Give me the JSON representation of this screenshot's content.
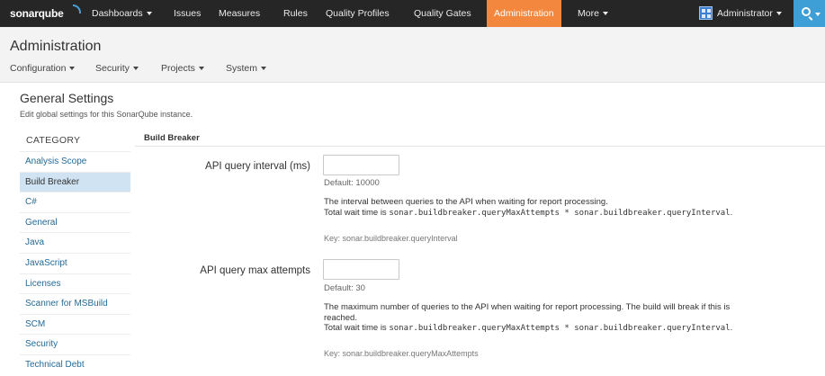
{
  "topnav": {
    "logo": "sonarqube",
    "items": [
      {
        "label": "Dashboards",
        "caret": true
      },
      {
        "label": "Issues"
      },
      {
        "label": "Measures"
      },
      {
        "label": "Rules"
      },
      {
        "label": "Quality Profiles"
      },
      {
        "label": "Quality Gates"
      },
      {
        "label": "Administration",
        "active": true
      },
      {
        "label": "More",
        "caret": true
      }
    ],
    "user": "Administrator",
    "search_icon": "search-icon",
    "colors": {
      "bar": "#262626",
      "active": "#f4873e",
      "search": "#3d9fd6"
    }
  },
  "header": {
    "title": "Administration",
    "menus": [
      "Configuration",
      "Security",
      "Projects",
      "System"
    ]
  },
  "general": {
    "title": "General Settings",
    "description": "Edit global settings for this SonarQube instance."
  },
  "sidebar": {
    "heading": "CATEGORY",
    "items": [
      "Analysis Scope",
      "Build Breaker",
      "C#",
      "General",
      "Java",
      "JavaScript",
      "Licenses",
      "Scanner for MSBuild",
      "SCM",
      "Security",
      "Technical Debt"
    ],
    "active": "Build Breaker"
  },
  "main": {
    "section_title": "Build Breaker",
    "settings": [
      {
        "label": "API query interval (ms)",
        "value": "",
        "default": "Default: 10000",
        "desc_lines": [
          "The interval between queries to the API when waiting for report processing."
        ],
        "total_prefix": "Total wait time is ",
        "total_code": "sonar.buildbreaker.queryMaxAttempts * sonar.buildbreaker.queryInterval",
        "total_suffix": ".",
        "key": "Key: sonar.buildbreaker.queryInterval"
      },
      {
        "label": "API query max attempts",
        "value": "",
        "default": "Default: 30",
        "desc_lines": [
          "The maximum number of queries to the API when waiting for report processing. The build will break if this is",
          "reached."
        ],
        "total_prefix": "Total wait time is ",
        "total_code": "sonar.buildbreaker.queryMaxAttempts * sonar.buildbreaker.queryInterval",
        "total_suffix": ".",
        "key": "Key: sonar.buildbreaker.queryMaxAttempts"
      }
    ]
  }
}
